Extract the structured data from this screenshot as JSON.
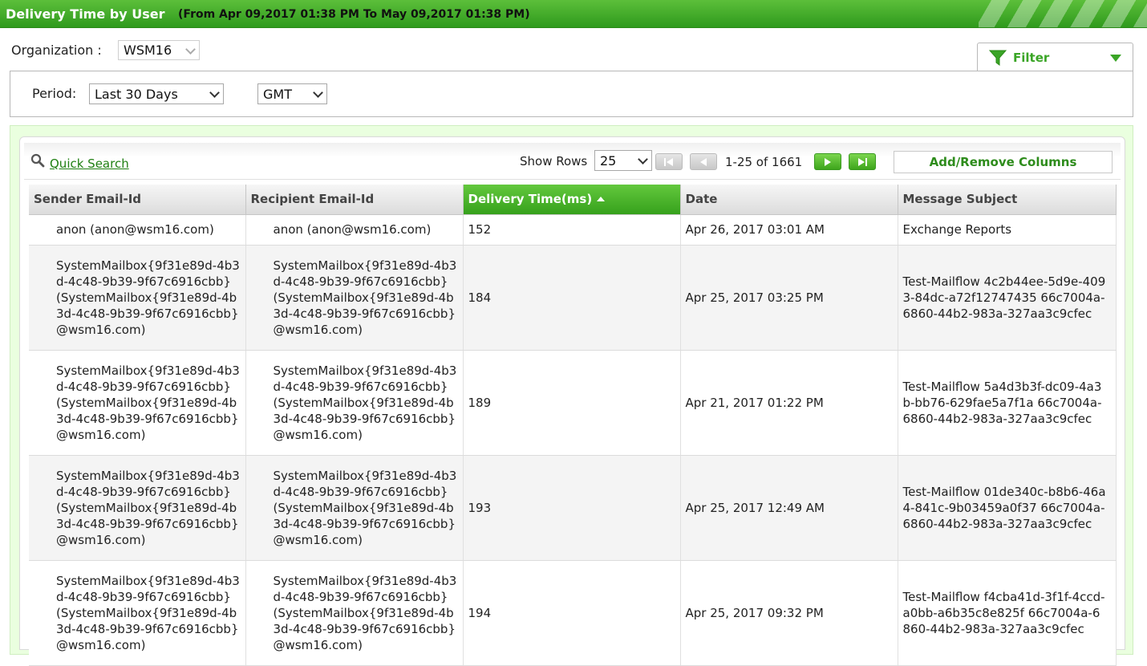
{
  "header": {
    "title": "Delivery Time by User",
    "range": "(From Apr 09,2017 01:38 PM To May 09,2017 01:38 PM)"
  },
  "organization": {
    "label": "Organization :",
    "value": "WSM16"
  },
  "filter": {
    "label": "Filter"
  },
  "period": {
    "label": "Period:",
    "value": "Last 30 Days",
    "timezone": "GMT"
  },
  "toolbar": {
    "quick_search": "Quick Search",
    "show_rows_label": "Show Rows",
    "show_rows_value": "25",
    "page_info": "1-25 of 1661",
    "add_remove": "Add/Remove Columns"
  },
  "table": {
    "columns": [
      "Sender Email-Id",
      "Recipient Email-Id",
      "Delivery Time(ms)",
      "Date",
      "Message Subject"
    ],
    "sorted_column": "Delivery Time(ms)",
    "rows": [
      {
        "sender": "anon (anon@wsm16.com)",
        "recipient": "anon (anon@wsm16.com)",
        "delivery": "152",
        "date": "Apr 26, 2017 03:01 AM",
        "subject": "Exchange Reports"
      },
      {
        "sender": "SystemMailbox{9f31e89d-4b3d-4c48-9b39-9f67c6916cbb} (SystemMailbox{9f31e89d-4b3d-4c48-9b39-9f67c6916cbb}@wsm16.com)",
        "recipient": "SystemMailbox{9f31e89d-4b3d-4c48-9b39-9f67c6916cbb} (SystemMailbox{9f31e89d-4b3d-4c48-9b39-9f67c6916cbb}@wsm16.com)",
        "delivery": "184",
        "date": "Apr 25, 2017 03:25 PM",
        "subject": "Test-Mailflow 4c2b44ee-5d9e-4093-84dc-a72f12747435 66c7004a-6860-44b2-983a-327aa3c9cfec"
      },
      {
        "sender": "SystemMailbox{9f31e89d-4b3d-4c48-9b39-9f67c6916cbb} (SystemMailbox{9f31e89d-4b3d-4c48-9b39-9f67c6916cbb}@wsm16.com)",
        "recipient": "SystemMailbox{9f31e89d-4b3d-4c48-9b39-9f67c6916cbb} (SystemMailbox{9f31e89d-4b3d-4c48-9b39-9f67c6916cbb}@wsm16.com)",
        "delivery": "189",
        "date": "Apr 21, 2017 01:22 PM",
        "subject": "Test-Mailflow 5a4d3b3f-dc09-4a3b-bb76-629fae5a7f1a 66c7004a-6860-44b2-983a-327aa3c9cfec"
      },
      {
        "sender": "SystemMailbox{9f31e89d-4b3d-4c48-9b39-9f67c6916cbb} (SystemMailbox{9f31e89d-4b3d-4c48-9b39-9f67c6916cbb}@wsm16.com)",
        "recipient": "SystemMailbox{9f31e89d-4b3d-4c48-9b39-9f67c6916cbb} (SystemMailbox{9f31e89d-4b3d-4c48-9b39-9f67c6916cbb}@wsm16.com)",
        "delivery": "193",
        "date": "Apr 25, 2017 12:49 AM",
        "subject": "Test-Mailflow 01de340c-b8b6-46a4-841c-9b03459a0f37 66c7004a-6860-44b2-983a-327aa3c9cfec"
      },
      {
        "sender": "SystemMailbox{9f31e89d-4b3d-4c48-9b39-9f67c6916cbb} (SystemMailbox{9f31e89d-4b3d-4c48-9b39-9f67c6916cbb}@wsm16.com)",
        "recipient": "SystemMailbox{9f31e89d-4b3d-4c48-9b39-9f67c6916cbb} (SystemMailbox{9f31e89d-4b3d-4c48-9b39-9f67c6916cbb}@wsm16.com)",
        "delivery": "194",
        "date": "Apr 25, 2017 09:32 PM",
        "subject": "Test-Mailflow f4cba41d-3f1f-4ccd-a0bb-a6b35c8e825f 66c7004a-6860-44b2-983a-327aa3c9cfec"
      }
    ]
  },
  "colors": {
    "accent_green": "#3aa526",
    "header_green": "#36a11c",
    "link_green": "#1f7f12",
    "panel_bg": "#eaffdf"
  }
}
